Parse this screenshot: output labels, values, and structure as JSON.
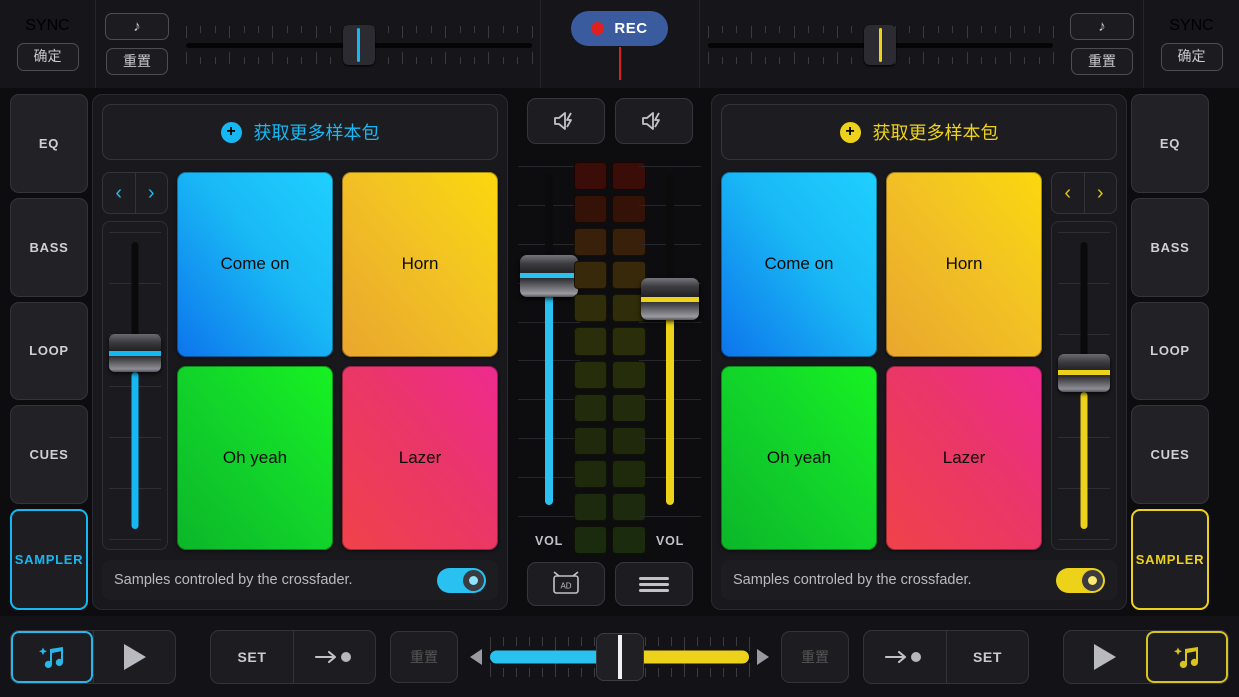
{
  "top": {
    "left": {
      "sync_label": "SYNC",
      "confirm_label": "确定",
      "note_icon": "music-note-icon",
      "reset_label": "重置",
      "tempo_value": 0,
      "tempo_color": "#16b8f3"
    },
    "rec": {
      "label": "REC",
      "dot_icon": "record-dot-icon",
      "active": true,
      "color": "#3a5c9e"
    },
    "right": {
      "sync_label": "SYNC",
      "confirm_label": "确定",
      "note_icon": "music-note-icon",
      "reset_label": "重置",
      "tempo_value": 0,
      "tempo_color": "#edd21c"
    }
  },
  "rails": {
    "left": {
      "items": [
        "EQ",
        "BASS",
        "LOOP",
        "CUES",
        "SAMPLER"
      ],
      "active": "SAMPLER",
      "accent": "#16b8f3"
    },
    "right": {
      "items": [
        "EQ",
        "BASS",
        "LOOP",
        "CUES",
        "SAMPLER"
      ],
      "active": "SAMPLER",
      "accent": "#edd21c"
    }
  },
  "decks": {
    "left": {
      "get_more_label": "获取更多样本包",
      "plus_icon": "plus-circle-icon",
      "prev_icon": "chevron-left-icon",
      "next_icon": "chevron-right-icon",
      "accent": "#16b8f3",
      "fader_percent": 62,
      "pads": [
        {
          "label": "Come on",
          "color": "blue"
        },
        {
          "label": "Horn",
          "color": "yellow"
        },
        {
          "label": "Oh yeah",
          "color": "green"
        },
        {
          "label": "Lazer",
          "color": "pink"
        }
      ],
      "footer_text": "Samples controled by the crossfader.",
      "toggle_on": true
    },
    "right": {
      "get_more_label": "获取更多样本包",
      "plus_icon": "plus-circle-icon",
      "prev_icon": "chevron-left-icon",
      "next_icon": "chevron-right-icon",
      "accent": "#edd21c",
      "fader_percent": 56,
      "pads": [
        {
          "label": "Come on",
          "color": "blue"
        },
        {
          "label": "Horn",
          "color": "yellow"
        },
        {
          "label": "Oh yeah",
          "color": "green"
        },
        {
          "label": "Lazer",
          "color": "pink"
        }
      ],
      "footer_text": "Samples controled by the crossfader.",
      "toggle_on": true
    }
  },
  "mixer": {
    "cue_left_icon": "speaker-cue-icon",
    "cue_right_icon": "speaker-cue-icon",
    "vol_left_label": "VOL",
    "vol_right_label": "VOL",
    "vol_left_percent": 72,
    "vol_right_percent": 65,
    "vol_left_color": "#29c1f0",
    "vol_right_color": "#ecd31a",
    "vu_rows": 12,
    "vu_columns": 2,
    "ad_button_icon": "ad-video-icon",
    "ad_button_label": "AD",
    "menu_button_icon": "hamburger-menu-icon"
  },
  "bottom": {
    "left": {
      "sampler_icon": "sampler-note-icon",
      "play_icon": "play-icon",
      "set_label": "SET",
      "goto_icon": "arrow-to-cue-icon",
      "reset_label": "重置",
      "accent": "#29b7ea"
    },
    "right": {
      "sampler_icon": "sampler-note-icon",
      "play_icon": "play-icon",
      "set_label": "SET",
      "goto_icon": "arrow-to-cue-icon",
      "reset_label": "重置",
      "accent": "#d9c41c"
    },
    "crossfader": {
      "position_percent": 50,
      "left_color": "#29c1f0",
      "right_color": "#edd21c",
      "arrow_left_icon": "triangle-left-icon",
      "arrow_right_icon": "triangle-right-icon"
    }
  }
}
